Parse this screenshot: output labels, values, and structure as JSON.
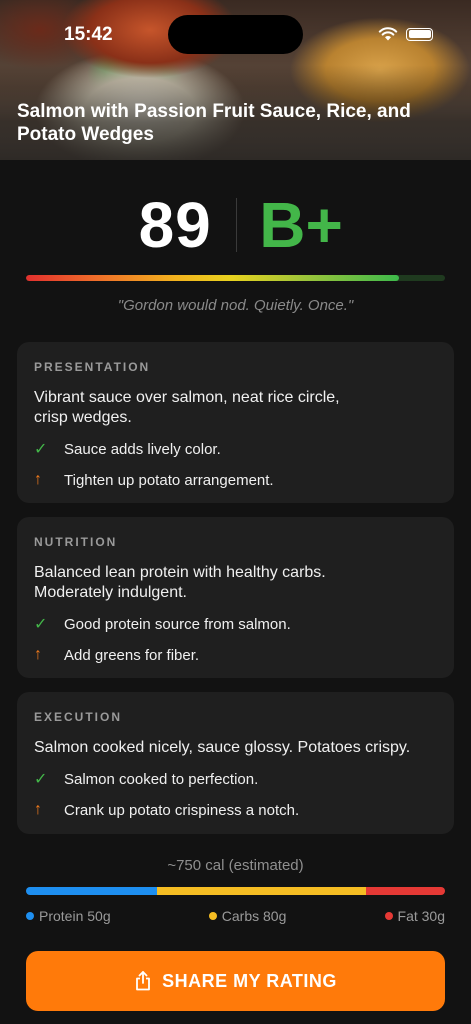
{
  "status_bar": {
    "time": "15:42"
  },
  "hero": {
    "title": "Salmon with Passion Fruit Sauce, Rice, and Potato Wedges"
  },
  "score": {
    "value": "89",
    "grade": "B+",
    "bar_fraction": 0.89,
    "quote": "\"Gordon would nod. Quietly. Once.\""
  },
  "cards": [
    {
      "label": "PRESENTATION",
      "summary": "Vibrant sauce over salmon, neat rice circle, crisp wedges.",
      "positive": "Sauce adds lively color.",
      "improve": "Tighten up potato arrangement."
    },
    {
      "label": "NUTRITION",
      "summary": "Balanced lean protein with healthy carbs. Moderately indulgent.",
      "positive": "Good protein source from salmon.",
      "improve": "Add greens for fiber."
    },
    {
      "label": "EXECUTION",
      "summary": "Salmon cooked nicely, sauce glossy. Potatoes crispy.",
      "positive": "Salmon cooked to perfection.",
      "improve": "Crank up potato crispiness a notch."
    }
  ],
  "icons": {
    "positive": "check-icon",
    "improve": "arrow-up-icon",
    "share": "share-icon"
  },
  "calories": "~750 cal (estimated)",
  "macros": [
    {
      "label": "Protein 50g",
      "grams": 50,
      "color": "#1e8ff0"
    },
    {
      "label": "Carbs 80g",
      "grams": 80,
      "color": "#f5bd23"
    },
    {
      "label": "Fat 30g",
      "grams": 30,
      "color": "#e53935"
    }
  ],
  "share_button": {
    "label": "SHARE MY RATING"
  },
  "colors": {
    "accent": "#ff7a0a",
    "grade": "#43b649"
  }
}
